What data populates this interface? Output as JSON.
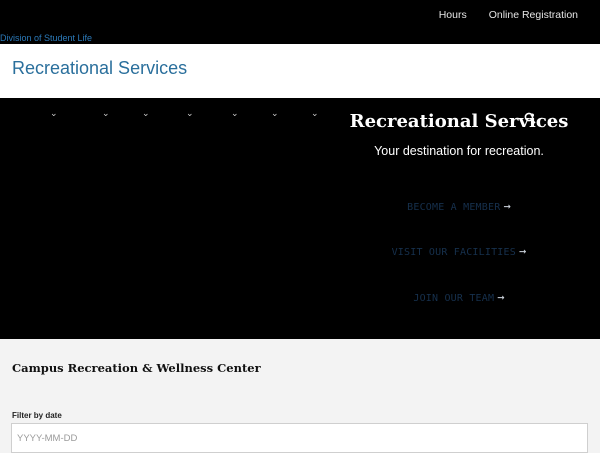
{
  "utility_nav": {
    "links": [
      "Hours",
      "Online Registration"
    ],
    "division_link": "Division of Student Life"
  },
  "site_header": {
    "title": "Recreational Services"
  },
  "main_nav": {
    "dropdown_count": 7,
    "icons": [
      "chevron-down-icon",
      "search-icon"
    ]
  },
  "hero": {
    "title": "Recreational Services",
    "subtitle": "Your destination for recreation.",
    "cta": [
      {
        "label": "BECOME A MEMBER",
        "arrow": "→"
      },
      {
        "label": "VISIT OUR FACILITIES",
        "arrow": "→"
      },
      {
        "label": "JOIN OUR TEAM",
        "arrow": "→"
      }
    ]
  },
  "content": {
    "section_title": "Campus Recreation & Wellness Center",
    "filter_label": "Filter by date",
    "date_input": {
      "placeholder": "YYYY-MM-DD",
      "value": ""
    }
  },
  "colors": {
    "top_bar": "#000000",
    "header_title": "#2a6f9c",
    "division_link": "#2b79b8",
    "hero_bg": "#000000",
    "cta_text": "#16304d",
    "content_bg": "#f3f3f3"
  }
}
